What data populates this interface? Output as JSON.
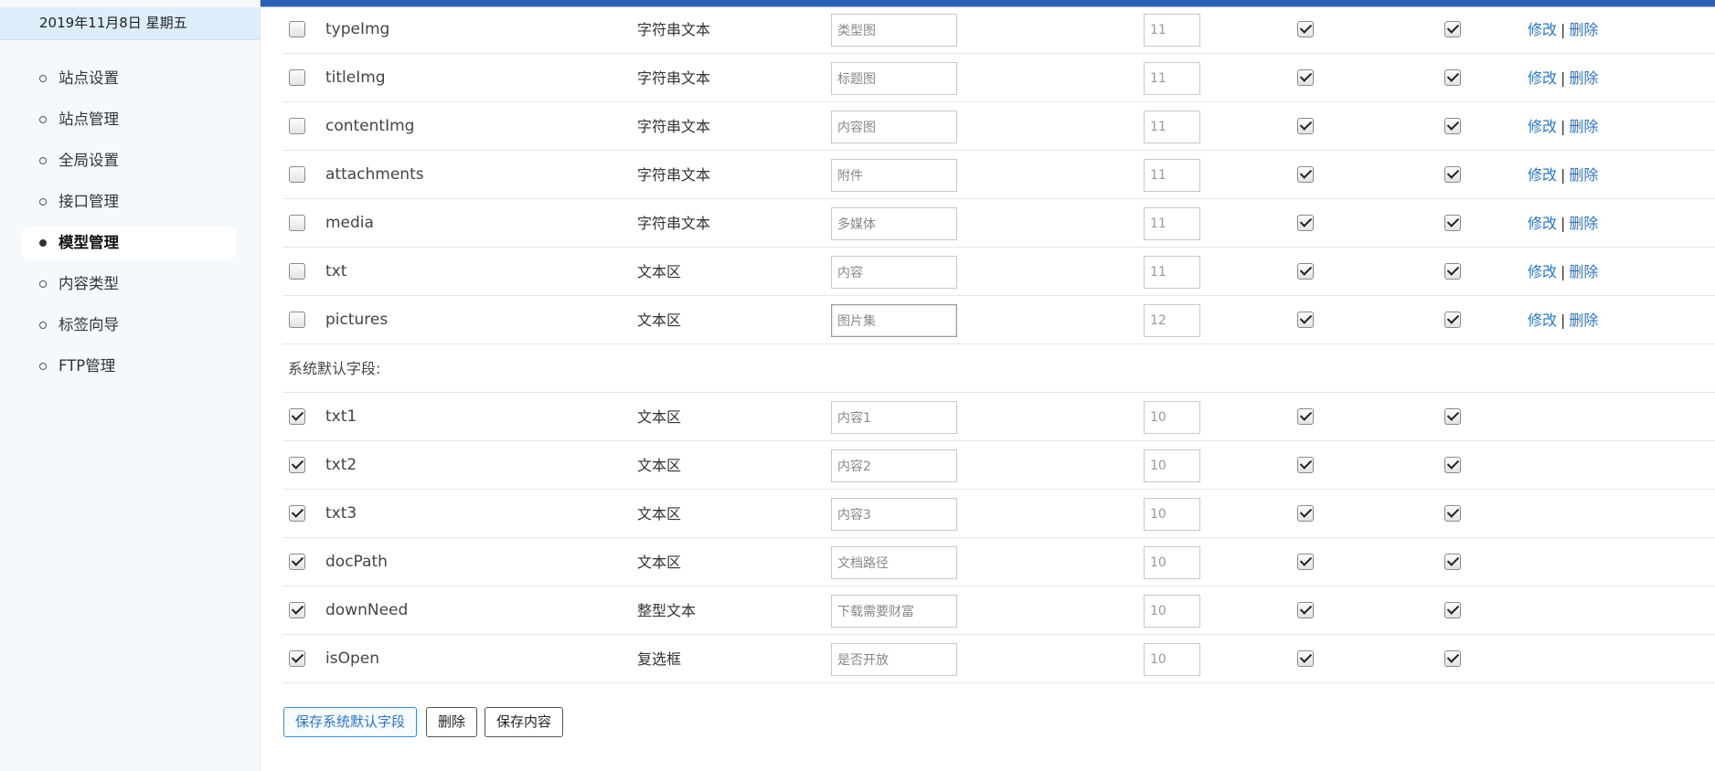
{
  "sidebar": {
    "date": "2019年11月8日 星期五",
    "items": [
      {
        "label": "站点设置",
        "active": false
      },
      {
        "label": "站点管理",
        "active": false
      },
      {
        "label": "全局设置",
        "active": false
      },
      {
        "label": "接口管理",
        "active": false
      },
      {
        "label": "模型管理",
        "active": true
      },
      {
        "label": "内容类型",
        "active": false
      },
      {
        "label": "标签向导",
        "active": false
      },
      {
        "label": "FTP管理",
        "active": false
      }
    ]
  },
  "custom_fields": [
    {
      "name": "typeImg",
      "type": "字符串文本",
      "label": "类型图",
      "order": "11",
      "selected": false,
      "col1": true,
      "col2": true
    },
    {
      "name": "titleImg",
      "type": "字符串文本",
      "label": "标题图",
      "order": "11",
      "selected": false,
      "col1": true,
      "col2": true
    },
    {
      "name": "contentImg",
      "type": "字符串文本",
      "label": "内容图",
      "order": "11",
      "selected": false,
      "col1": true,
      "col2": true
    },
    {
      "name": "attachments",
      "type": "字符串文本",
      "label": "附件",
      "order": "11",
      "selected": false,
      "col1": true,
      "col2": true
    },
    {
      "name": "media",
      "type": "字符串文本",
      "label": "多媒体",
      "order": "11",
      "selected": false,
      "col1": true,
      "col2": true
    },
    {
      "name": "txt",
      "type": "文本区",
      "label": "内容",
      "order": "11",
      "selected": false,
      "col1": true,
      "col2": true
    },
    {
      "name": "pictures",
      "type": "文本区",
      "label": "图片集",
      "order": "12",
      "selected": false,
      "col1": true,
      "col2": true
    }
  ],
  "actions": {
    "edit": "修改",
    "separator": "|",
    "delete": "删除"
  },
  "system_section_label": "系统默认字段:",
  "system_fields": [
    {
      "name": "txt1",
      "type": "文本区",
      "label": "内容1",
      "order": "10",
      "selected": true,
      "col1": true,
      "col2": true
    },
    {
      "name": "txt2",
      "type": "文本区",
      "label": "内容2",
      "order": "10",
      "selected": true,
      "col1": true,
      "col2": true
    },
    {
      "name": "txt3",
      "type": "文本区",
      "label": "内容3",
      "order": "10",
      "selected": true,
      "col1": true,
      "col2": true
    },
    {
      "name": "docPath",
      "type": "文本区",
      "label": "文档路径",
      "order": "10",
      "selected": true,
      "col1": true,
      "col2": true
    },
    {
      "name": "downNeed",
      "type": "整型文本",
      "label": "下载需要财富",
      "order": "10",
      "selected": true,
      "col1": true,
      "col2": true
    },
    {
      "name": "isOpen",
      "type": "复选框",
      "label": "是否开放",
      "order": "10",
      "selected": true,
      "col1": true,
      "col2": true
    }
  ],
  "buttons": {
    "save_system": "保存系统默认字段",
    "delete": "删除",
    "save_content": "保存内容"
  }
}
